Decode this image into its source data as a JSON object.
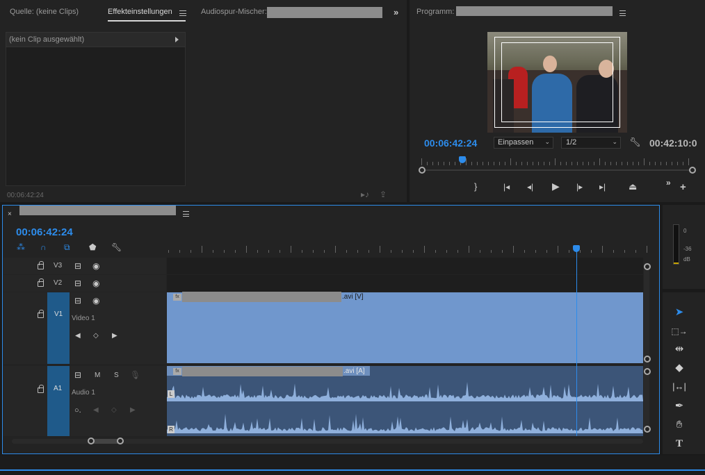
{
  "source_panel": {
    "tabs": [
      {
        "label": "Quelle: (keine Clips)",
        "active": false
      },
      {
        "label": "Effekteinstellungen",
        "active": true
      },
      {
        "label": "Audiospur-Mischer:",
        "active": false
      }
    ],
    "clip_header": "(kein Clip ausgewählt)",
    "timecode": "00:06:42:24"
  },
  "program_monitor": {
    "title": "Programm:",
    "current_timecode": "00:06:42:24",
    "zoom_select": "Einpassen",
    "resolution_select": "1/2",
    "duration_timecode": "00:42:10:0",
    "playhead_fraction": 0.15
  },
  "timeline": {
    "timecode": "00:06:42:24",
    "tracks": {
      "v3": {
        "name": "V3"
      },
      "v2": {
        "name": "V2"
      },
      "v1": {
        "name": "V1",
        "label": "Video 1",
        "clip_suffix": ".avi [V]"
      },
      "a1": {
        "name": "A1",
        "label": "Audio 1",
        "clip_suffix": ".avi [A]",
        "mute": "M",
        "solo": "S",
        "ch_left": "L",
        "ch_right": "R",
        "fx": "fx"
      }
    },
    "playhead_fraction": 0.86
  },
  "meter": {
    "labels": [
      "0",
      "-36",
      "dB"
    ]
  },
  "colors": {
    "accent": "#2d8ceb",
    "clip_video": "#7097cd",
    "clip_audio": "#3c5578",
    "waveform": "#8fb0dc",
    "track_header_selected": "#1f5a8a"
  }
}
